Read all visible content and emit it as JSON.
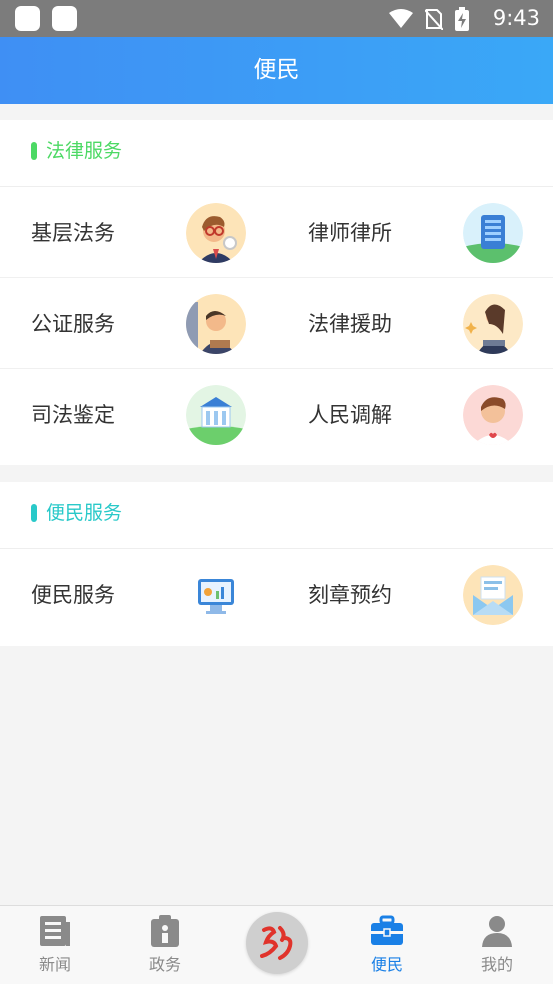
{
  "status_bar": {
    "time": "9:43"
  },
  "header": {
    "title": "便民"
  },
  "sections": [
    {
      "title": "法律服务",
      "accent": "#4cd964",
      "rows": [
        [
          {
            "label": "基层法务",
            "icon": "lawyer-man-icon"
          },
          {
            "label": "律师律所",
            "icon": "office-building-icon"
          }
        ],
        [
          {
            "label": "公证服务",
            "icon": "notary-man-icon"
          },
          {
            "label": "法律援助",
            "icon": "woman-lawyer-icon"
          }
        ],
        [
          {
            "label": "司法鉴定",
            "icon": "courthouse-icon"
          },
          {
            "label": "人民调解",
            "icon": "mediator-man-icon"
          }
        ]
      ]
    },
    {
      "title": "便民服务",
      "accent": "#29c9c9",
      "rows": [
        [
          {
            "label": "便民服务",
            "icon": "computer-monitor-icon"
          },
          {
            "label": "刻章预约",
            "icon": "envelope-box-icon"
          }
        ]
      ]
    }
  ],
  "tabs": [
    {
      "label": "新闻",
      "icon": "news-icon",
      "active": false
    },
    {
      "label": "政务",
      "icon": "clipboard-id-icon",
      "active": false
    },
    {
      "label": "便民",
      "icon": "briefcase-icon",
      "active": true
    },
    {
      "label": "我的",
      "icon": "person-icon",
      "active": false
    }
  ],
  "center_logo": {
    "icon": "calligraphy-logo-icon"
  },
  "colors": {
    "header_start": "#3f8ff4",
    "header_end": "#3aa8f7",
    "tab_active": "#1a80e6",
    "tab_inactive": "#8a8a8a"
  }
}
